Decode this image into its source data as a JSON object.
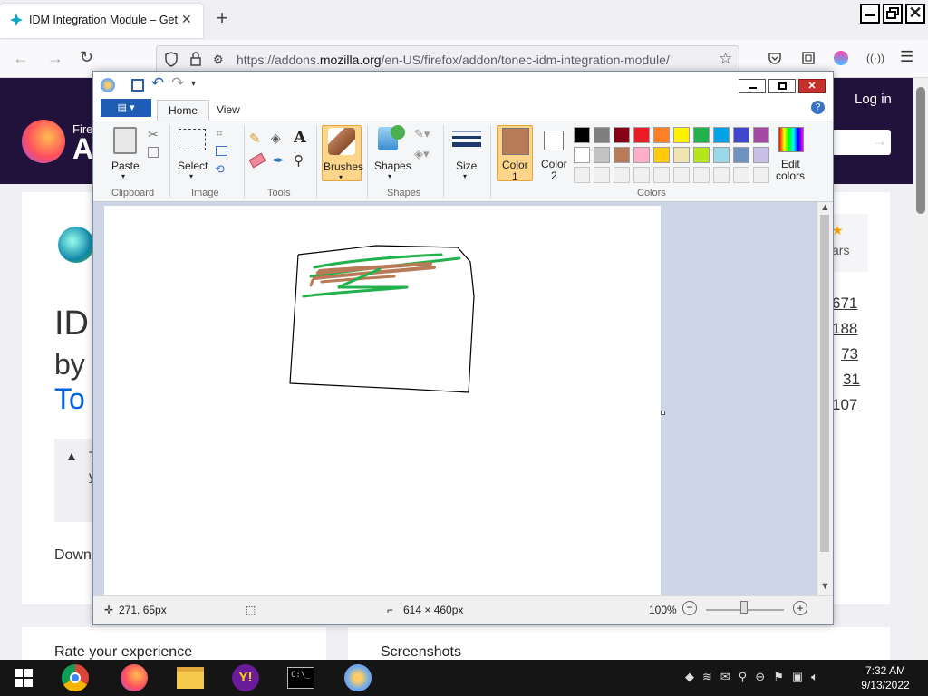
{
  "browser": {
    "tab_title": "IDM Integration Module – Get t",
    "url_domain_prefix": "https://addons.",
    "url_domain": "mozilla.org",
    "url_path": "/en-US/firefox/addon/tonec-idm-integration-module/"
  },
  "page": {
    "login": "Log in",
    "logo_small": "Fire",
    "logo_big": "A",
    "title_fragment": "ID",
    "by_fragment": "by",
    "author_fragment": "To",
    "notice_fragment": "T",
    "notice_fragment2": "y",
    "download_fragment": "Down",
    "rating_fragment": "ars",
    "stats": [
      "671",
      "188",
      "73",
      "31",
      "107"
    ],
    "rate_experience": "Rate your experience",
    "screenshots": "Screenshots"
  },
  "paint": {
    "tabs": [
      "Home",
      "View"
    ],
    "clipboard": {
      "paste": "Paste",
      "label": "Clipboard"
    },
    "image": {
      "select": "Select",
      "label": "Image"
    },
    "tools": {
      "label": "Tools"
    },
    "brushes": "Brushes",
    "shapes": {
      "btn": "Shapes",
      "label": "Shapes"
    },
    "size": "Size",
    "color1": "Color\n1",
    "color1_l1": "Color",
    "color1_l2": "1",
    "color2_l1": "Color",
    "color2_l2": "2",
    "edit_colors_l1": "Edit",
    "edit_colors_l2": "colors",
    "colors_label": "Colors",
    "palette_row1": [
      "#000000",
      "#7f7f7f",
      "#880015",
      "#ed1c24",
      "#ff7f27",
      "#fff200",
      "#22b14c",
      "#00a2e8",
      "#3f48cc",
      "#a349a4"
    ],
    "palette_row2": [
      "#ffffff",
      "#c3c3c3",
      "#b97a57",
      "#ffaec9",
      "#ffc90e",
      "#efe4b0",
      "#b5e61d",
      "#99d9ea",
      "#7092be",
      "#c8bfe7"
    ],
    "color1_value": "#b97a57",
    "color2_value": "#ffffff",
    "status": {
      "cursor": "271, 65px",
      "size": "614 × 460px",
      "zoom": "100%"
    }
  },
  "taskbar": {
    "time": "7:32 AM",
    "date": "9/13/2022"
  }
}
